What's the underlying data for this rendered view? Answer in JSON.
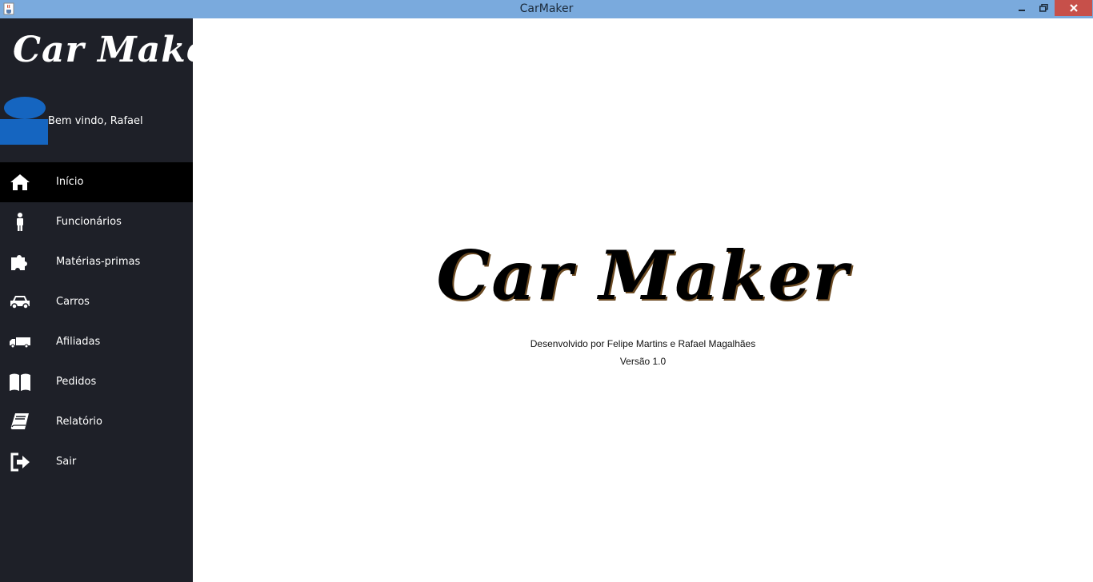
{
  "window": {
    "title": "CarMaker",
    "icon": "java-cup-icon",
    "controls": [
      "minimize-icon",
      "restore-icon",
      "close-icon"
    ]
  },
  "sidebar": {
    "logo_text": "Car Maker",
    "welcome_text": "Bem vindo, Rafael",
    "avatar_icon": "user-avatar-icon",
    "items": [
      {
        "label": "Início",
        "icon": "home-icon",
        "active": true
      },
      {
        "label": "Funcionários",
        "icon": "person-icon",
        "active": false
      },
      {
        "label": "Matérias-primas",
        "icon": "puzzle-icon",
        "active": false
      },
      {
        "label": "Carros",
        "icon": "car-icon",
        "active": false
      },
      {
        "label": "Afiliadas",
        "icon": "truck-icon",
        "active": false
      },
      {
        "label": "Pedidos",
        "icon": "book-open-icon",
        "active": false
      },
      {
        "label": "Relatório",
        "icon": "book-icon",
        "active": false
      },
      {
        "label": "Sair",
        "icon": "sign-out-icon",
        "active": false
      }
    ]
  },
  "main": {
    "logo_text": "Car Maker",
    "credits": "Desenvolvido por Felipe Martins e Rafael Magalhães",
    "version": "Versão 1.0"
  },
  "colors": {
    "titlebar": "#7aaadd",
    "close_button": "#c7504a",
    "sidebar_bg": "#1e2028",
    "active_item_bg": "#000000",
    "avatar": "#1565c0"
  }
}
